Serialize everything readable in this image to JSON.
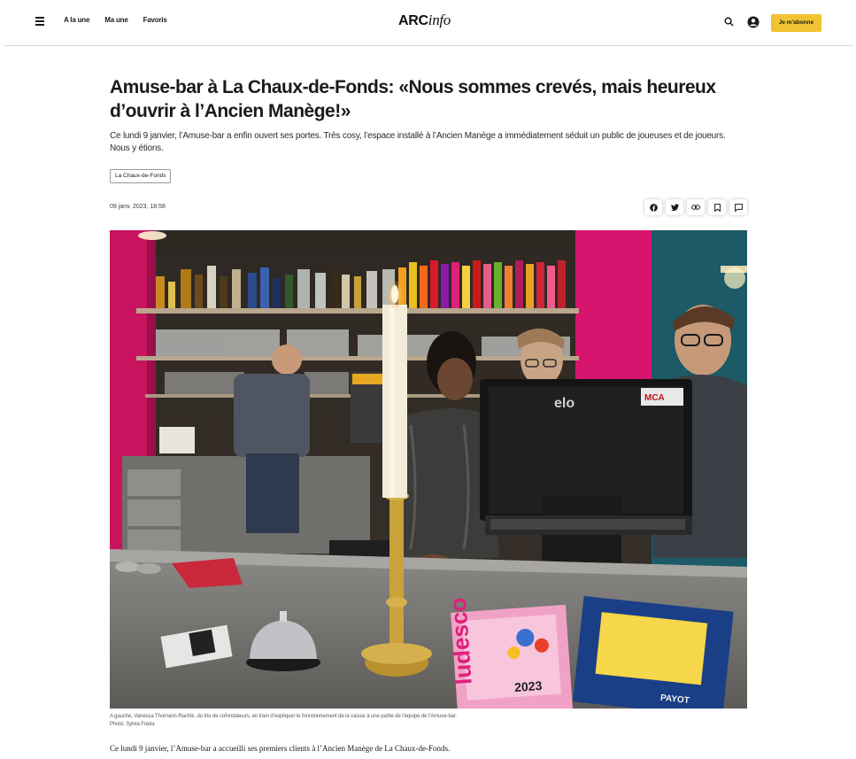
{
  "header": {
    "nav": [
      "A la une",
      "Ma une",
      "Favoris"
    ],
    "logo_arc": "ARC",
    "logo_info": "info",
    "subscribe_label": "Je m'abonne"
  },
  "article": {
    "title": "Amuse-bar à La Chaux-de-Fonds: «Nous sommes crevés, mais heureux d’ouvrir à l’Ancien Manège!»",
    "lead": "Ce lundi 9 janvier, l’Amuse-bar a enfin ouvert ses portes. Très cosy, l’espace installé à l’Ancien Manège a immédiatement séduit un public de joueuses et de joueurs. Nous y étions.",
    "tag": "La Chaux-de-Fonds",
    "date": "09 janv. 2023, 18:58",
    "share_icons": [
      "facebook-icon",
      "twitter-icon",
      "link-icon",
      "bookmark-icon",
      "comment-icon"
    ],
    "photo": {
      "sign_brand": "elo",
      "sign_badge": "MCA",
      "magazine_title": "ludesco",
      "magazine_date": "2023",
      "flyer_brand": "PAYOT"
    },
    "caption_line1": "A gauche, Vanessa Thomann-Rachik, du trio de cofondateurs, en train d’expliquer le fonctionnement de la caisse à une partie de l’équipe de l’Amuse-bar.",
    "caption_line2": "Photo: Sylvia Freda",
    "body_first": "Ce lundi 9 janvier, l’Amuse-bar a accueilli ses premiers clients à l’Ancien Manège de La Chaux-de-Fonds."
  },
  "colors": {
    "accent": "#f1c232",
    "magenta_wall": "#d7146e",
    "teal_wall": "#1b5a66"
  }
}
